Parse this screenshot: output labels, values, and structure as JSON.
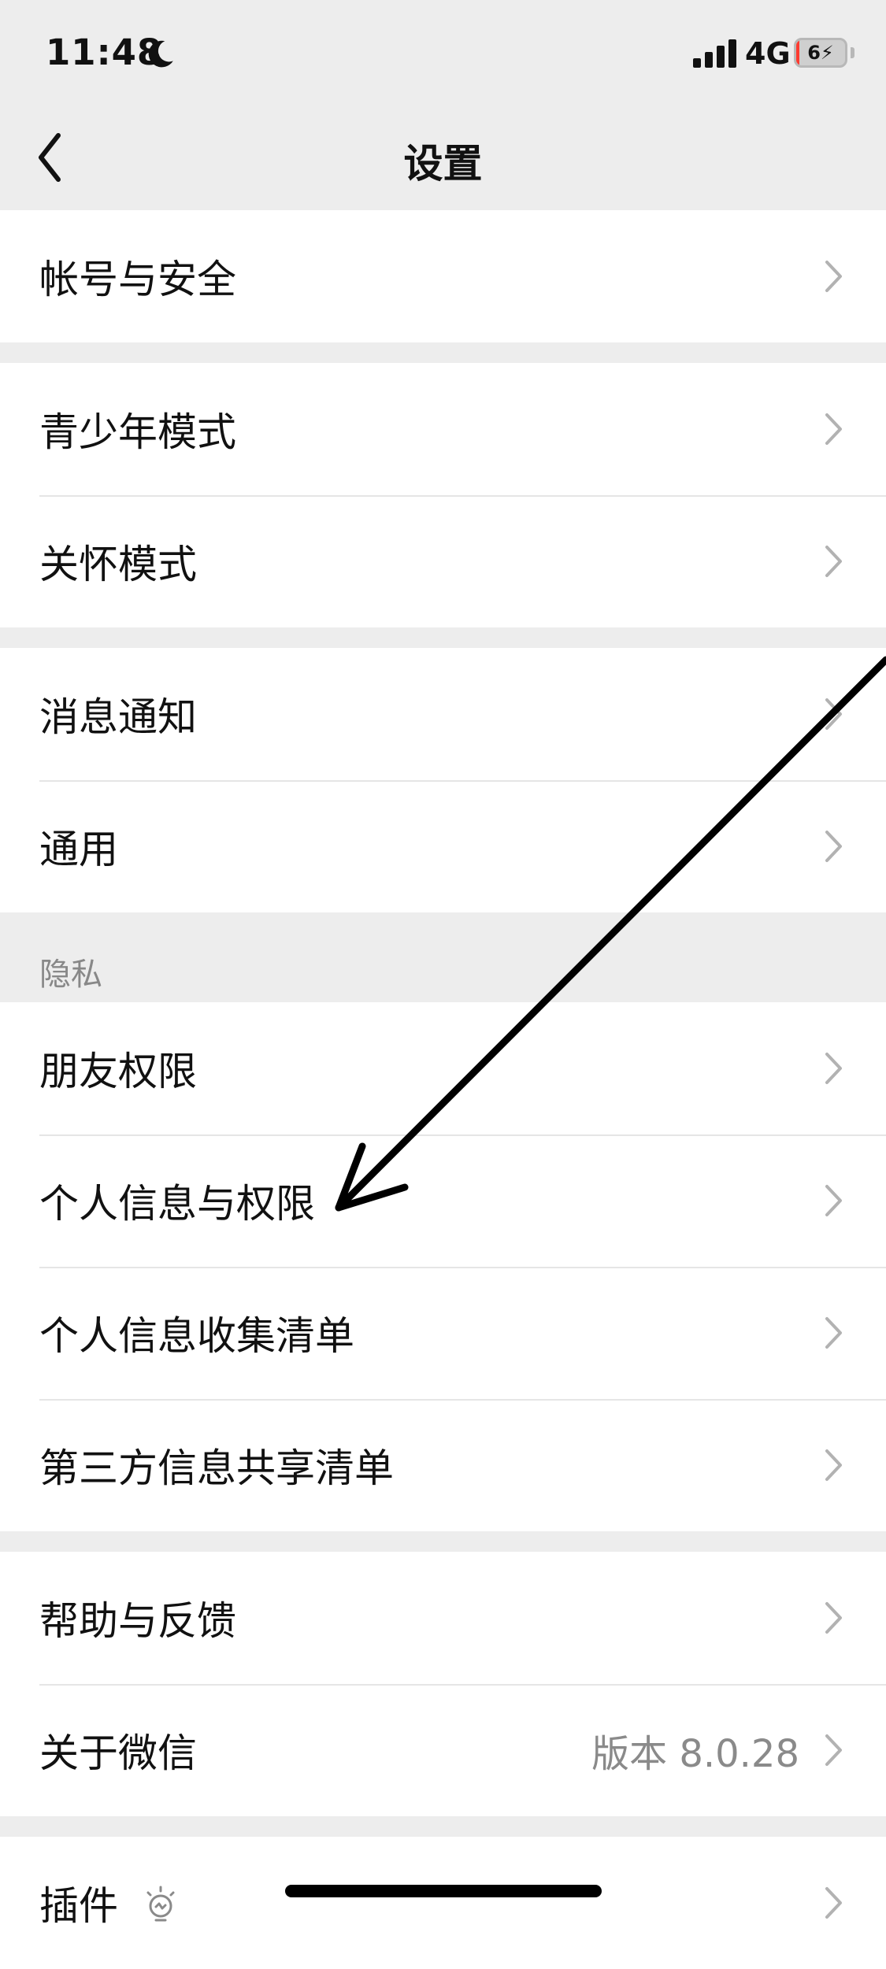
{
  "status_bar": {
    "time": "11:48",
    "network": "4G",
    "battery_level": "6",
    "battery_fraction": 0.06,
    "icons": [
      "moon-icon",
      "signal-icon",
      "battery-icon",
      "charging-bolt-icon"
    ]
  },
  "nav": {
    "title": "设置",
    "back_icon": "chevron-left-icon"
  },
  "groups": [
    {
      "items": [
        {
          "label": "帐号与安全"
        }
      ]
    },
    {
      "items": [
        {
          "label": "青少年模式"
        },
        {
          "label": "关怀模式"
        }
      ]
    },
    {
      "items": [
        {
          "label": "消息通知"
        },
        {
          "label": "通用"
        }
      ]
    },
    {
      "header": "隐私",
      "items": [
        {
          "label": "朋友权限"
        },
        {
          "label": "个人信息与权限"
        },
        {
          "label": "个人信息收集清单"
        },
        {
          "label": "第三方信息共享清单"
        }
      ]
    },
    {
      "items": [
        {
          "label": "帮助与反馈"
        },
        {
          "label": "关于微信",
          "value": "版本 8.0.28"
        }
      ]
    },
    {
      "items": [
        {
          "label": "插件",
          "icon": "lightbulb-icon"
        }
      ]
    }
  ],
  "colors": {
    "background": "#ededed",
    "row_background": "#ffffff",
    "text": "#111111",
    "secondary_text": "#888888",
    "divider": "#e5e5e5",
    "chevron": "#b2b2b2",
    "annotation": "#000000"
  }
}
